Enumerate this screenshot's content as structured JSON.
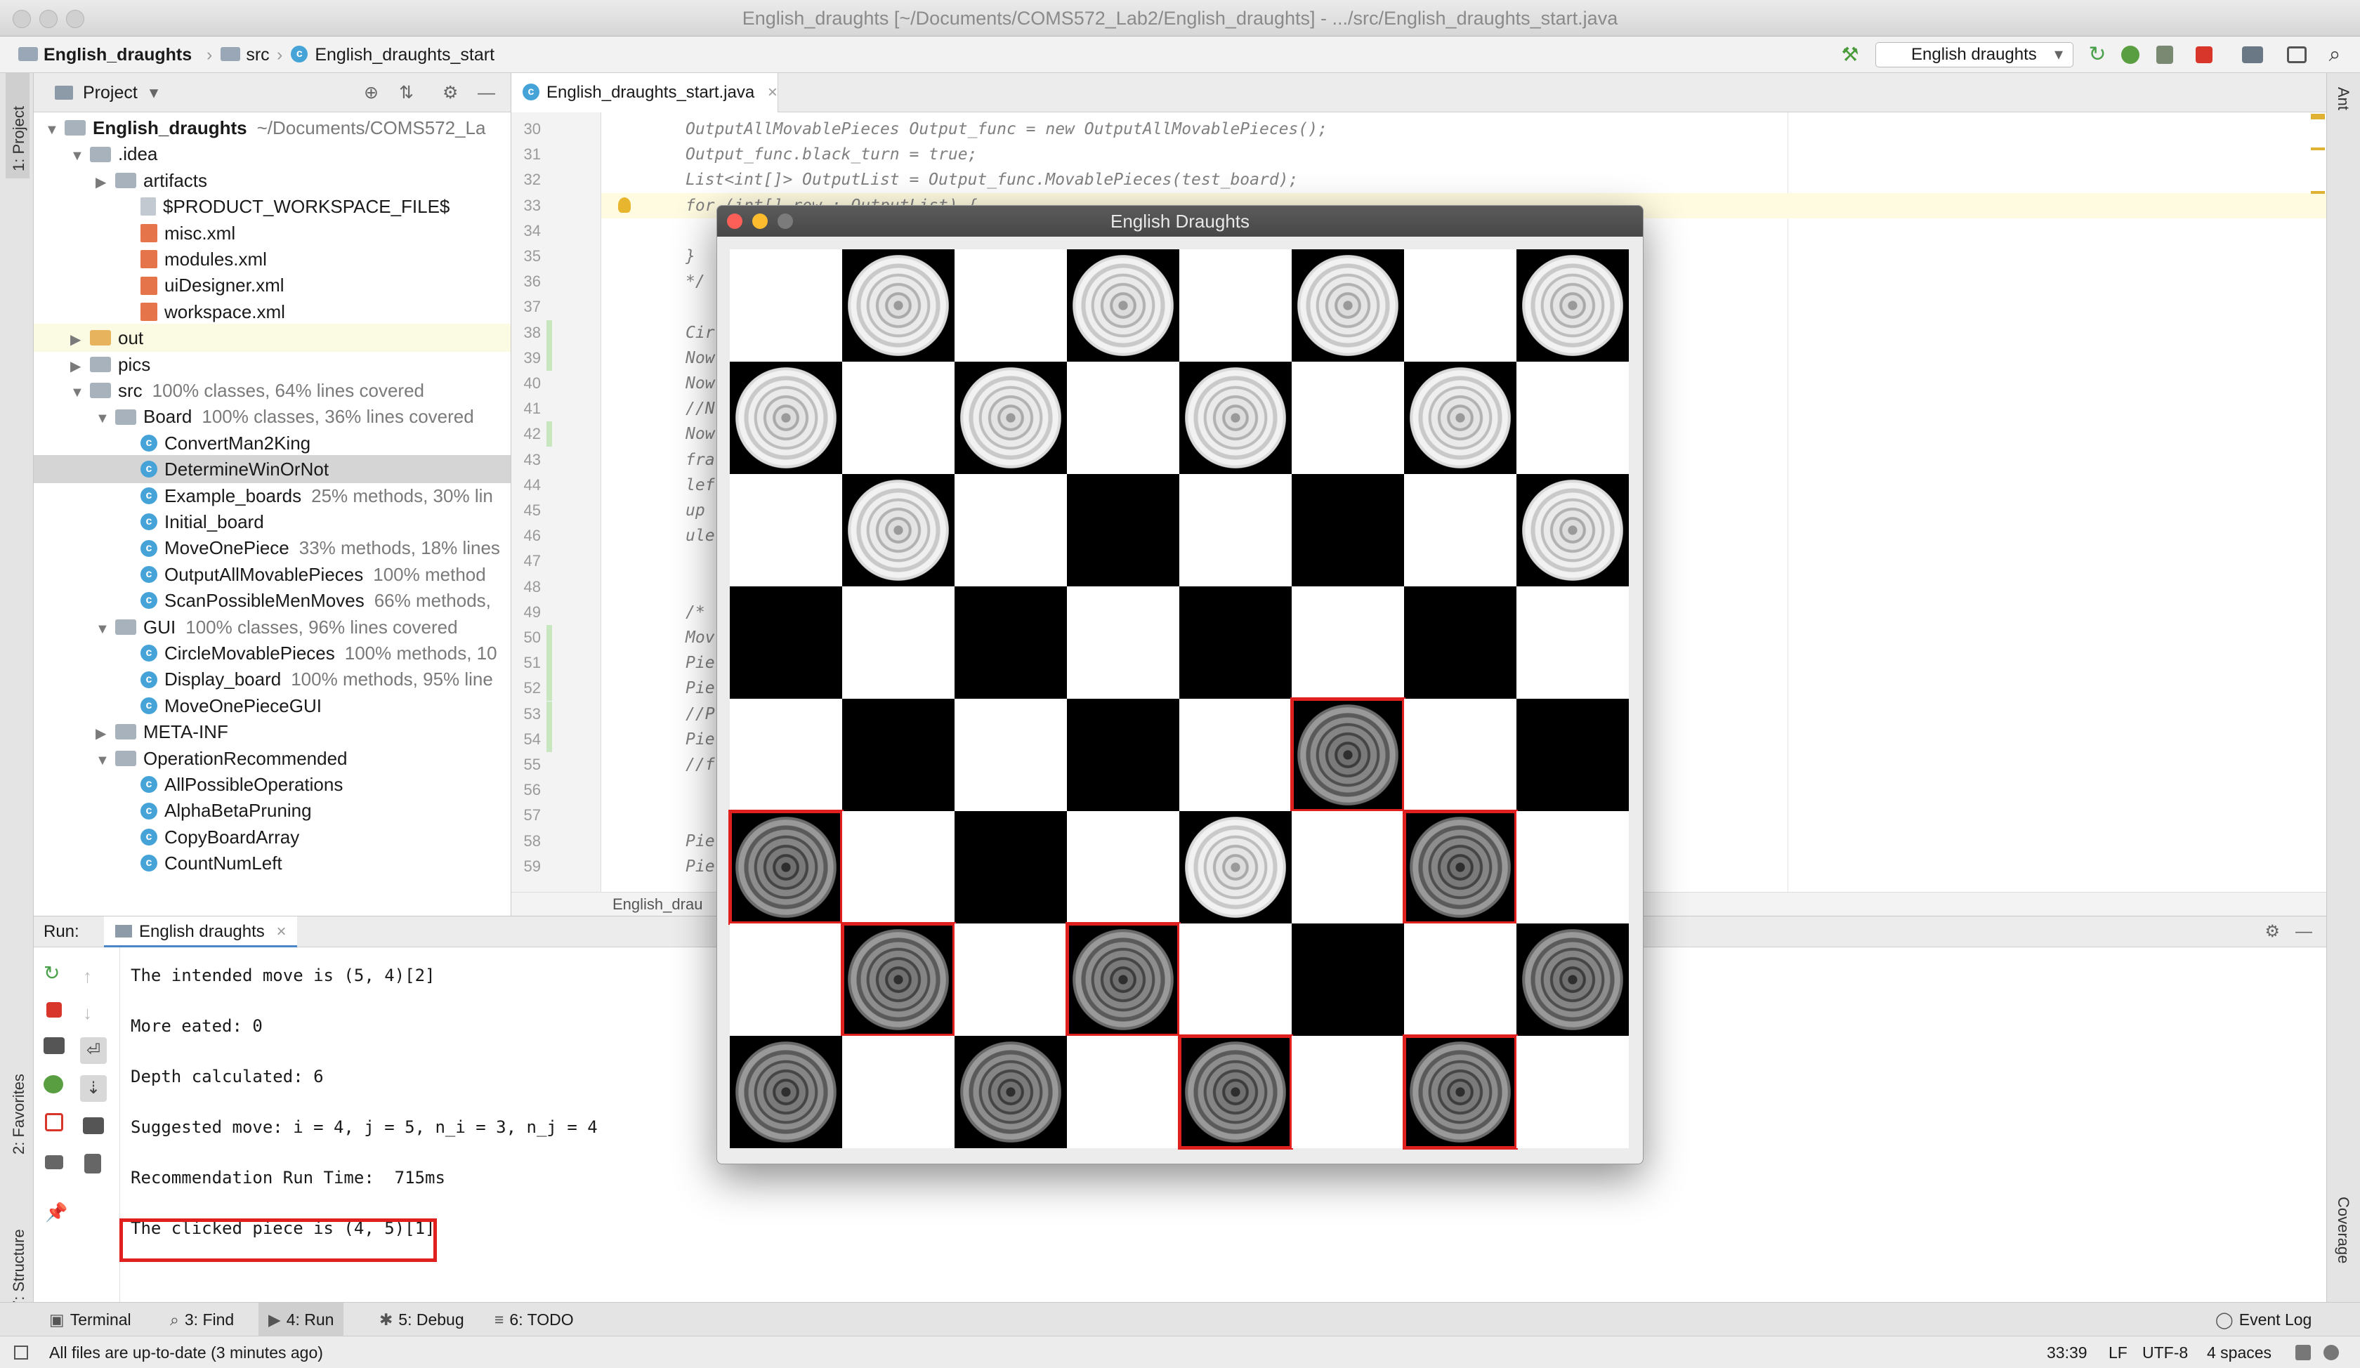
{
  "window": {
    "title": "English_draughts [~/Documents/COMS572_Lab2/English_draughts] - .../src/English_draughts_start.java"
  },
  "navbar": {
    "crumbs": [
      "English_draughts",
      "src",
      "English_draughts_start"
    ],
    "run_config": "English draughts"
  },
  "project": {
    "header": "Project",
    "tree": [
      {
        "label": "English_draughts",
        "note": "~/Documents/COMS572_La",
        "icon": "folder-icon",
        "depth": 0,
        "arrow": "▼",
        "bold": true
      },
      {
        "label": ".idea",
        "note": "",
        "icon": "folder-icon",
        "depth": 1,
        "arrow": "▼"
      },
      {
        "label": "artifacts",
        "note": "",
        "icon": "folder-icon",
        "depth": 2,
        "arrow": "▶"
      },
      {
        "label": "$PRODUCT_WORKSPACE_FILE$",
        "note": "",
        "icon": "file-icon",
        "depth": 3,
        "arrow": ""
      },
      {
        "label": "misc.xml",
        "note": "",
        "icon": "xml-icon",
        "depth": 3,
        "arrow": ""
      },
      {
        "label": "modules.xml",
        "note": "",
        "icon": "xml-icon",
        "depth": 3,
        "arrow": ""
      },
      {
        "label": "uiDesigner.xml",
        "note": "",
        "icon": "xml-icon",
        "depth": 3,
        "arrow": ""
      },
      {
        "label": "workspace.xml",
        "note": "",
        "icon": "xml-icon",
        "depth": 3,
        "arrow": ""
      },
      {
        "label": "out",
        "note": "",
        "icon": "folder-orange-icon",
        "depth": 1,
        "arrow": "▶",
        "bg": "#fbfae2"
      },
      {
        "label": "pics",
        "note": "",
        "icon": "folder-icon",
        "depth": 1,
        "arrow": "▶"
      },
      {
        "label": "src",
        "note": "100% classes, 64% lines covered",
        "icon": "folder-icon",
        "depth": 1,
        "arrow": "▼"
      },
      {
        "label": "Board",
        "note": "100% classes, 36% lines covered",
        "icon": "package-icon",
        "depth": 2,
        "arrow": "▼"
      },
      {
        "label": "ConvertMan2King",
        "note": "",
        "icon": "class-icon",
        "depth": 3,
        "arrow": ""
      },
      {
        "label": "DetermineWinOrNot",
        "note": "",
        "icon": "class-icon",
        "depth": 3,
        "arrow": "",
        "bg": "#d5d5d5"
      },
      {
        "label": "Example_boards",
        "note": "25% methods, 30% lin",
        "icon": "class-icon",
        "depth": 3,
        "arrow": ""
      },
      {
        "label": "Initial_board",
        "note": "",
        "icon": "class-icon",
        "depth": 3,
        "arrow": ""
      },
      {
        "label": "MoveOnePiece",
        "note": "33% methods, 18% lines",
        "icon": "class-icon",
        "depth": 3,
        "arrow": ""
      },
      {
        "label": "OutputAllMovablePieces",
        "note": "100% method",
        "icon": "class-icon",
        "depth": 3,
        "arrow": ""
      },
      {
        "label": "ScanPossibleMenMoves",
        "note": "66% methods,",
        "icon": "class-icon",
        "depth": 3,
        "arrow": ""
      },
      {
        "label": "GUI",
        "note": "100% classes, 96% lines covered",
        "icon": "package-icon",
        "depth": 2,
        "arrow": "▼"
      },
      {
        "label": "CircleMovablePieces",
        "note": "100% methods, 10",
        "icon": "class-icon",
        "depth": 3,
        "arrow": ""
      },
      {
        "label": "Display_board",
        "note": "100% methods, 95% line",
        "icon": "class-icon",
        "depth": 3,
        "arrow": ""
      },
      {
        "label": "MoveOnePieceGUI",
        "note": "",
        "icon": "class-icon",
        "depth": 3,
        "arrow": ""
      },
      {
        "label": "META-INF",
        "note": "",
        "icon": "folder-icon",
        "depth": 2,
        "arrow": "▶"
      },
      {
        "label": "OperationRecommended",
        "note": "",
        "icon": "package-icon",
        "depth": 2,
        "arrow": "▼"
      },
      {
        "label": "AllPossibleOperations",
        "note": "",
        "icon": "class-icon",
        "depth": 3,
        "arrow": ""
      },
      {
        "label": "AlphaBetaPruning",
        "note": "",
        "icon": "class-icon",
        "depth": 3,
        "arrow": ""
      },
      {
        "label": "CopyBoardArray",
        "note": "",
        "icon": "class-icon",
        "depth": 3,
        "arrow": ""
      },
      {
        "label": "CountNumLeft",
        "note": "",
        "icon": "class-icon",
        "depth": 3,
        "arrow": ""
      }
    ]
  },
  "editor": {
    "tab": "English_draughts_start.java",
    "breadcrumb": "English_drau",
    "line_numbers": [
      "30",
      "31",
      "32",
      "33",
      "34",
      "35",
      "36",
      "37",
      "38",
      "39",
      "40",
      "41",
      "42",
      "43",
      "44",
      "45",
      "46",
      "47",
      "48",
      "49",
      "50",
      "51",
      "52",
      "53",
      "54",
      "55",
      "56",
      "57",
      "58",
      "59"
    ],
    "lines": [
      {
        "n": 0,
        "indent": 0,
        "text": "OutputAllMovablePieces Output_func = new OutputAllMovablePieces();"
      },
      {
        "n": 1,
        "indent": 0,
        "text": "Output_func.black_turn = true;"
      },
      {
        "n": 2,
        "indent": 0,
        "text": "List<int[]> OutputList = Output_func.MovablePieces(test_board);"
      },
      {
        "n": 3,
        "indent": 0,
        "text": "for (int[] row : OutputList) {"
      },
      {
        "n": 5,
        "indent": 0,
        "text": "}"
      },
      {
        "n": 6,
        "indent": 0,
        "text": " */"
      },
      {
        "n": 8,
        "indent": 0,
        "text": "Cir"
      },
      {
        "n": 9,
        "indent": 0,
        "text": "Now"
      },
      {
        "n": 10,
        "indent": 0,
        "text": "Now"
      },
      {
        "n": 11,
        "indent": 0,
        "text": "//N"
      },
      {
        "n": 12,
        "indent": 0,
        "text": "Now"
      },
      {
        "n": 13,
        "indent": 0,
        "text": "fra"
      },
      {
        "n": 14,
        "indent": 0,
        "text": "lef"
      },
      {
        "n": 15,
        "indent": 0,
        "text": "up"
      },
      {
        "n": 16,
        "indent": 0,
        "text": "ule"
      },
      {
        "n": 19,
        "indent": 0,
        "text": "/*"
      },
      {
        "n": 20,
        "indent": 0,
        "text": "Mov"
      },
      {
        "n": 21,
        "indent": 0,
        "text": "Pie"
      },
      {
        "n": 22,
        "indent": 0,
        "text": "Pie"
      },
      {
        "n": 23,
        "indent": 0,
        "text": "//P"
      },
      {
        "n": 24,
        "indent": 0,
        "text": "Pie"
      },
      {
        "n": 25,
        "indent": 0,
        "text": "//f"
      },
      {
        "n": 28,
        "indent": 0,
        "text": "Pie"
      },
      {
        "n": 29,
        "indent": 0,
        "text": "Pie"
      }
    ]
  },
  "run": {
    "label": "Run:",
    "tab": "English draughts",
    "console": [
      "The intended move is (5, 4)[2]",
      "More eated: 0",
      "Depth calculated: 6",
      "Suggested move: i = 4, j = 5, n_i = 3, n_j = 4",
      "Recommendation Run Time:  715ms",
      "The clicked piece is (4, 5)[1]"
    ]
  },
  "bottom_tabs": [
    "Terminal",
    "3: Find",
    "4: Run",
    "5: Debug",
    "6: TODO"
  ],
  "event_log": "Event Log",
  "status": {
    "message": "All files are up-to-date (3 minutes ago)",
    "position": "33:39",
    "line_sep": "LF",
    "encoding": "UTF-8",
    "indent": "4 spaces"
  },
  "side_tabs": {
    "left": [
      "1: Project",
      "2: Favorites",
      "7: Structure"
    ],
    "right": [
      "Ant",
      "Coverage"
    ]
  },
  "game": {
    "title": "English Draughts",
    "board": [
      [
        "",
        "W",
        "",
        "W",
        "",
        "W",
        "",
        "W"
      ],
      [
        "W",
        "",
        "W",
        "",
        "W",
        "",
        "W",
        ""
      ],
      [
        "",
        "W",
        "",
        "",
        "",
        "",
        "",
        "W"
      ],
      [
        "",
        "",
        "",
        "",
        "",
        "",
        "",
        ""
      ],
      [
        "",
        "",
        "",
        "",
        "",
        "B",
        "",
        ""
      ],
      [
        "B",
        "",
        "",
        "",
        "W",
        "",
        "B",
        ""
      ],
      [
        "",
        "B",
        "",
        "B",
        "",
        "",
        "",
        "B"
      ],
      [
        "B",
        "",
        "B",
        "",
        "B",
        "",
        "B",
        ""
      ]
    ],
    "highlighted": [
      [
        4,
        5
      ],
      [
        5,
        0
      ],
      [
        5,
        6
      ],
      [
        6,
        1
      ],
      [
        6,
        3
      ],
      [
        7,
        4
      ],
      [
        7,
        6
      ]
    ],
    "colors": {
      "highlight": "#e0201f",
      "dark": "#000000",
      "light": "#ffffff"
    }
  }
}
